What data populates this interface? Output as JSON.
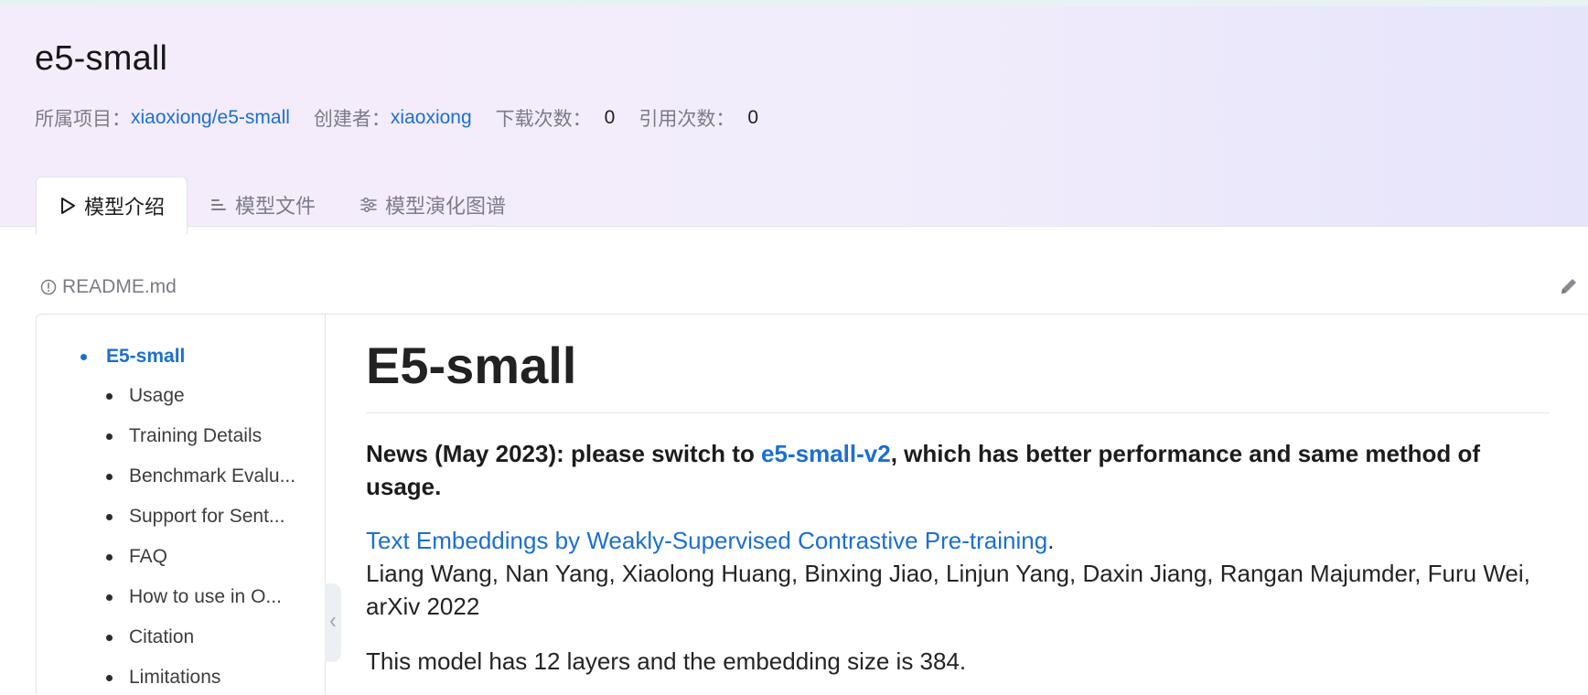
{
  "header": {
    "title": "e5-small",
    "meta": {
      "project_label": "所属项目：",
      "project_value": "xiaoxiong/e5-small",
      "creator_label": "创建者：",
      "creator_value": "xiaoxiong",
      "downloads_label": "下载次数：",
      "downloads_value": "0",
      "citations_label": "引用次数：",
      "citations_value": "0"
    }
  },
  "tabs": [
    {
      "label": "模型介绍",
      "icon": "play-outline-icon",
      "active": true
    },
    {
      "label": "模型文件",
      "icon": "file-lines-icon",
      "active": false
    },
    {
      "label": "模型演化图谱",
      "icon": "sliders-icon",
      "active": false
    }
  ],
  "readme": {
    "filename": "README.md",
    "icon": "info-circle-icon",
    "edit_icon": "pencil-icon"
  },
  "toc": {
    "top": "E5-small",
    "items": [
      "Usage",
      "Training Details",
      "Benchmark Evalu...",
      "Support for Sent...",
      "FAQ",
      "How to use in O...",
      "Citation",
      "Limitations"
    ],
    "collapse_icon": "chevron-left-icon"
  },
  "doc": {
    "heading": "E5-small",
    "news_before": "News (May 2023): please switch to ",
    "news_link": "e5-small-v2",
    "news_after": ", which has better performance and same method of usage.",
    "paper_link": "Text Embeddings by Weakly-Supervised Contrastive Pre-training",
    "paper_period": ".",
    "authors": "Liang Wang, Nan Yang, Xiaolong Huang, Binxing Jiao, Linjun Yang, Daxin Jiang, Rangan Majumder, Furu Wei, arXiv 2022",
    "model_info": "This model has 12 layers and the embedding size is 384."
  },
  "colors": {
    "link": "#1b6fd1",
    "header_gradient_start": "#f5ecfb",
    "header_gradient_end": "#e6e4fb"
  }
}
